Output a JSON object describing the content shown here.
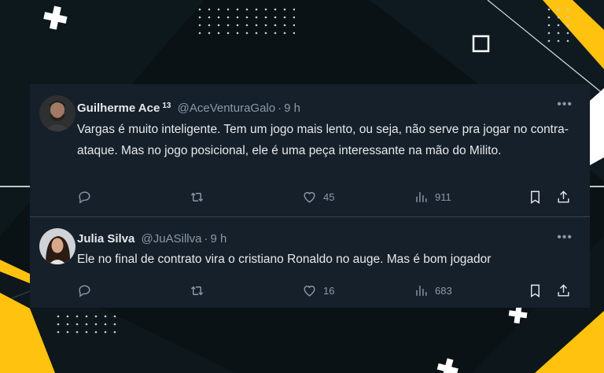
{
  "colors": {
    "background": "#0a1216",
    "card": "#15202b",
    "accent_yellow": "#ffc20e",
    "text_primary": "#e7e9ea",
    "text_secondary": "#8b98a5"
  },
  "tweets": [
    {
      "name": "Guilherme Ace",
      "badge": "13",
      "handle": "@AceVenturaGalo",
      "separator": "·",
      "time": "9 h",
      "text": "Vargas é muito inteligente. Tem um jogo mais lento, ou seja, não serve pra jogar no contra-ataque. Mas no jogo posicional, ele é uma peça interessante na mão do Milito.",
      "likes": "45",
      "views": "911",
      "more": "•••"
    },
    {
      "name": "Julia Silva",
      "handle": "@JuASillva",
      "separator": "·",
      "time": "9 h",
      "text": "Ele no final de contrato vira o cristiano Ronaldo no auge. Mas é bom jogador",
      "likes": "16",
      "views": "683",
      "more": "•••"
    }
  ],
  "icons": [
    "reply-icon",
    "retweet-icon",
    "like-icon",
    "views-icon",
    "bookmark-icon",
    "share-icon"
  ]
}
